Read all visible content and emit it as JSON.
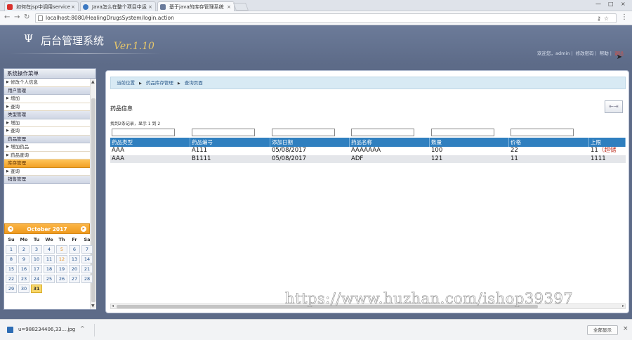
{
  "browser": {
    "tabs": [
      {
        "title": "如何在jsp中调用service",
        "icon_color": "#d9302c"
      },
      {
        "title": "Java怎么在整个项目中运",
        "icon_color": "#3b78c2"
      },
      {
        "title": "基于java的库存管理系统",
        "icon_color": "#6a7b9c"
      }
    ],
    "tab_close_glyph": "×",
    "window_controls": [
      "—",
      "□",
      "×"
    ],
    "url": "localhost:8080/HealingDrugsSystem/login.action"
  },
  "header": {
    "logo_symbol": "Ψ",
    "app_title": "后台管理系统",
    "version": "Ver.1.10",
    "welcome": "欢迎您，admin",
    "links": [
      "修改密码",
      "帮助",
      "退出"
    ],
    "separator": "|"
  },
  "sidebar": {
    "title": "系统操作菜单",
    "entries": [
      {
        "kind": "item",
        "label": "修改个人信息"
      },
      {
        "kind": "group",
        "label": "用户管理"
      },
      {
        "kind": "item",
        "label": "增加"
      },
      {
        "kind": "item",
        "label": "查询"
      },
      {
        "kind": "group",
        "label": "类型管理"
      },
      {
        "kind": "item",
        "label": "增加"
      },
      {
        "kind": "item",
        "label": "查询"
      },
      {
        "kind": "group",
        "label": "药品管理"
      },
      {
        "kind": "item",
        "label": "增加药品"
      },
      {
        "kind": "item",
        "label": "药品查询"
      },
      {
        "kind": "group",
        "label": "库存管理",
        "active": true
      },
      {
        "kind": "item",
        "label": "查询"
      },
      {
        "kind": "group",
        "label": "销售管理"
      }
    ]
  },
  "calendar": {
    "month_label": "October 2017",
    "prev": "◂",
    "next": "▸",
    "weekdays": [
      "Su",
      "Mo",
      "Tu",
      "We",
      "Th",
      "Fr",
      "Sa"
    ],
    "leading_blanks": 0,
    "days": [
      1,
      2,
      3,
      4,
      5,
      6,
      7,
      8,
      9,
      10,
      11,
      12,
      13,
      14,
      15,
      16,
      17,
      18,
      19,
      20,
      21,
      22,
      23,
      24,
      25,
      26,
      27,
      28,
      29,
      30,
      31
    ],
    "today": 31,
    "highlight": [
      5,
      12
    ]
  },
  "content": {
    "breadcrumb": [
      "当前位置",
      "药品库存管理",
      "查询页面"
    ],
    "section_title": "药品信息",
    "tool_button": "⇤⇥",
    "record_info": "找到2条记录，显示 1 到 2",
    "columns": [
      "药品类型",
      "药品编号",
      "添加日期",
      "药品名称",
      "数量",
      "价格",
      "上限"
    ],
    "rows": [
      [
        "AAA",
        "A111",
        "05/08/2017",
        "AAAAAAA",
        "100",
        "22",
        "11"
      ],
      [
        "AAA",
        "B1111",
        "05/08/2017",
        "ADF",
        "121",
        "11",
        "1111"
      ]
    ],
    "row0_warning": "（超储"
  },
  "watermark": "https://www.huzhan.com/ishop39397",
  "downloads": {
    "file": "u=988234406,33....jpg",
    "caret": "^",
    "show_all": "全部显示",
    "close": "×"
  }
}
